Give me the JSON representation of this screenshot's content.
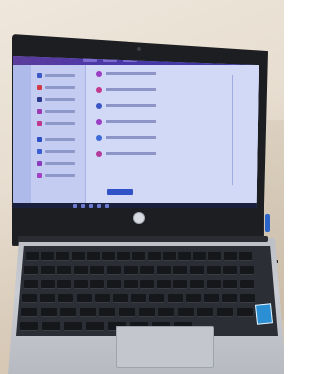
{
  "scene": {
    "subject": "laptop-on-desk",
    "colors": {
      "wall": "#e7ddd0",
      "bezel": "#1c1e22",
      "screen": "#c3cdf3",
      "app_titlebar": "#4a38a8",
      "accent_button": "#2f53c7",
      "deck": "#c1c4ca",
      "keys": "#15171b",
      "sticker": "#2c8fd4",
      "cable_tip": "#2b65c9"
    },
    "icons": {
      "logo": "brand-logo-icon",
      "camera": "webcam-icon"
    }
  }
}
